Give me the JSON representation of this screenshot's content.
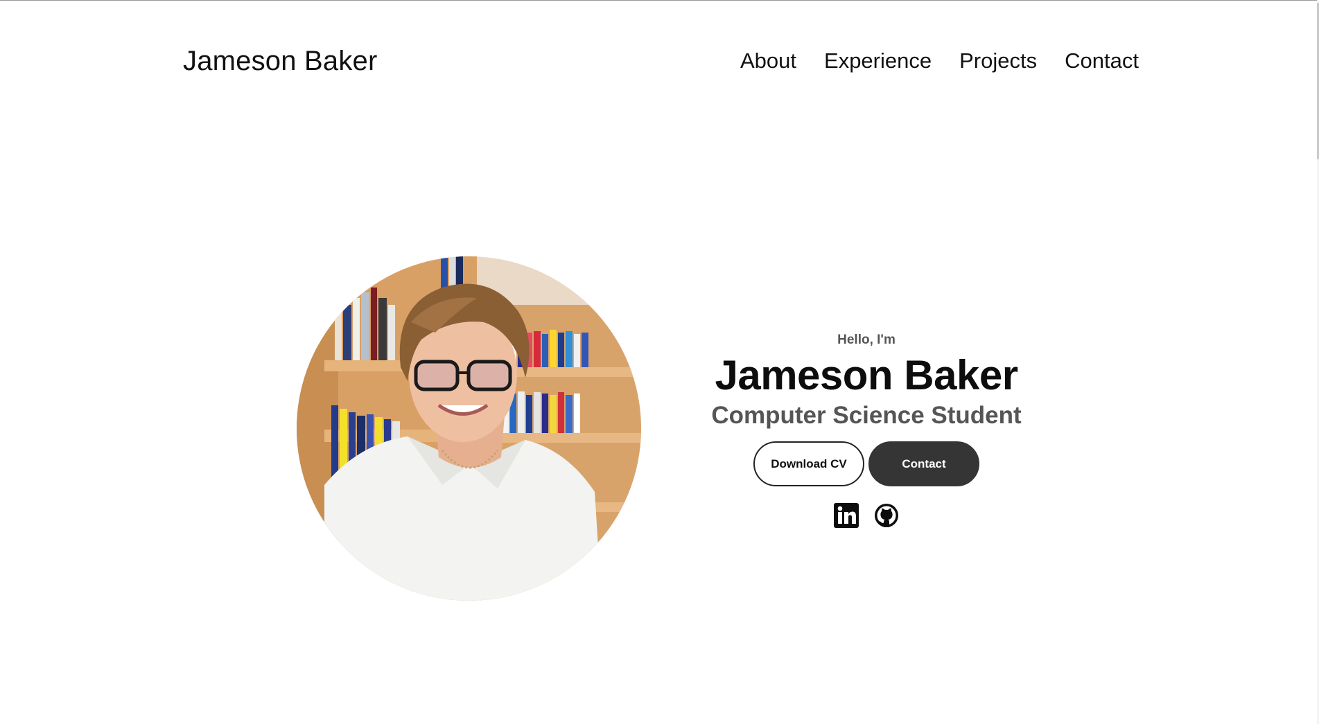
{
  "nav": {
    "logo": "Jameson Baker",
    "links": [
      {
        "label": "About"
      },
      {
        "label": "Experience"
      },
      {
        "label": "Projects"
      },
      {
        "label": "Contact"
      }
    ]
  },
  "hero": {
    "profile_image_alt": "Profile picture",
    "greeting": "Hello, I'm",
    "name": "Jameson Baker",
    "title": "Computer Science Student",
    "buttons": {
      "download_cv": "Download CV",
      "contact": "Contact"
    },
    "socials": [
      {
        "icon": "linkedin-icon",
        "label": "LinkedIn"
      },
      {
        "icon": "github-icon",
        "label": "GitHub"
      }
    ]
  },
  "colors": {
    "text_primary": "#111111",
    "text_secondary": "#555555",
    "button_solid": "#353535",
    "background": "#ffffff"
  }
}
